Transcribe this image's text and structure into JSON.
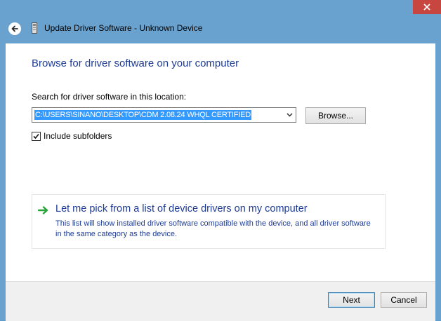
{
  "window": {
    "title": "Update Driver Software - Unknown Device"
  },
  "icons": {
    "back": "back-arrow-icon",
    "device": "device-icon",
    "close": "close-icon",
    "pick": "green-arrow-icon"
  },
  "colors": {
    "frame": "#6aa2cf",
    "close_button": "#c7463f",
    "heading": "#1e3c96",
    "selection": "#3399ff"
  },
  "main": {
    "heading": "Browse for driver software on your computer",
    "search_label": "Search for driver software in this location:",
    "path_value": "C:\\USERS\\SINANO\\DESKTOP\\CDM 2.08.24 WHQL CERTIFIED",
    "browse_label": "Browse...",
    "include_subfolders": {
      "label": "Include subfolders",
      "checked": true
    },
    "pick_option": {
      "title": "Let me pick from a list of device drivers on my computer",
      "description": "This list will show installed driver software compatible with the device, and all driver software in the same category as the device."
    }
  },
  "footer": {
    "next_label": "Next",
    "cancel_label": "Cancel"
  }
}
